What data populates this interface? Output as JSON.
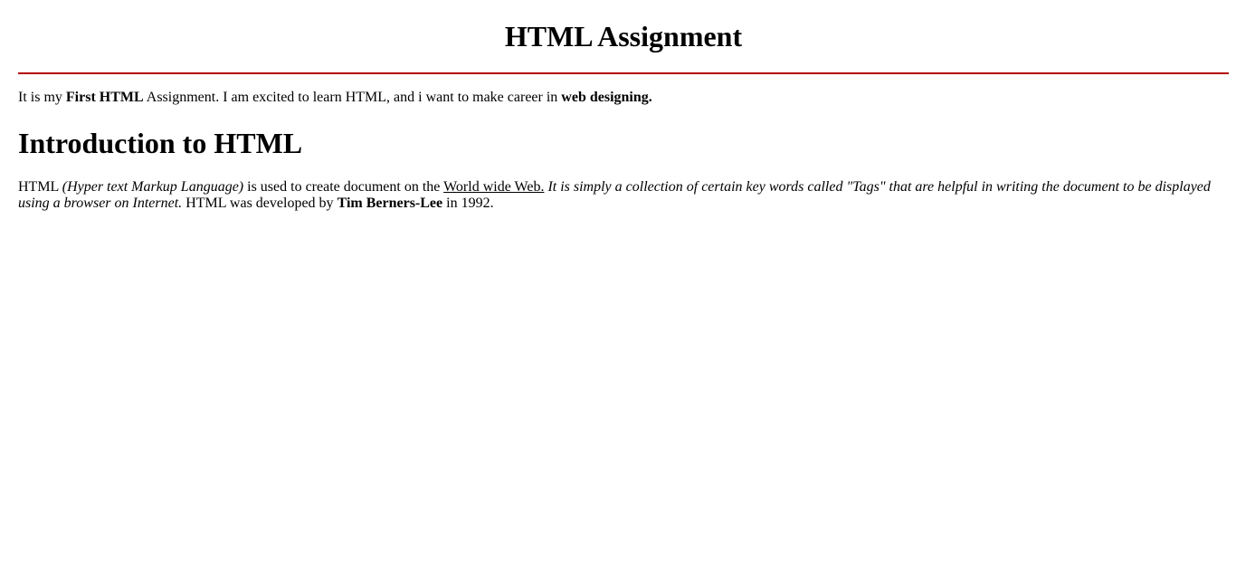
{
  "page": {
    "title": "HTML Assignment",
    "rule_color": "#b30000"
  },
  "intro": {
    "t1": "It is my ",
    "b1": "First HTML",
    "t2": " Assignment. I am excited to learn HTML, and i want to make career in ",
    "b2": "web designing."
  },
  "section": {
    "heading": "Introduction to HTML",
    "t1": "HTML ",
    "i1": "(Hyper text Markup Language)",
    "t2": " is used to create document on the ",
    "link": "World wide Web.",
    "i2": " It is simply a collection of certain key words called \"Tags\" that are helpful in writing the document to be displayed using a browser on Internet.",
    "t3": " HTML was developed by ",
    "b1": "Tim Berners-Lee",
    "t4": " in 1992."
  }
}
